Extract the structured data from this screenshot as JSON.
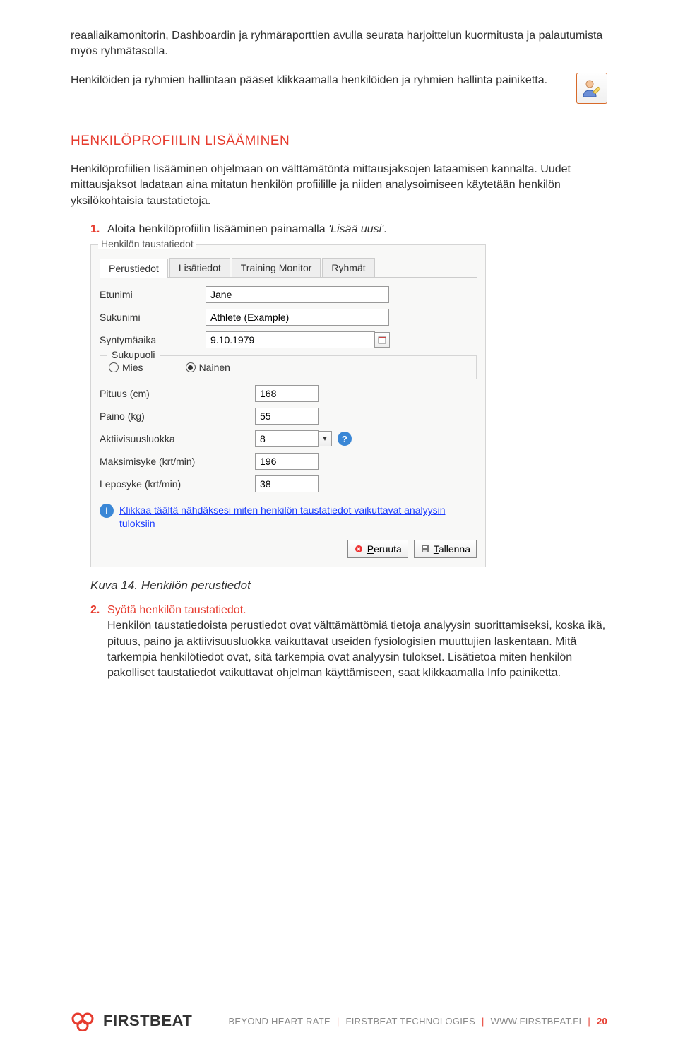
{
  "intro": {
    "p1": "reaaliaikamonitorin, Dashboardin ja ryhmäraporttien avulla seurata harjoittelun kuormitusta ja palautumista myös ryhmätasolla.",
    "p2": "Henkilöiden ja ryhmien hallintaan pääset klikkaamalla henkilöiden ja ryhmien hallinta painiketta."
  },
  "section_heading": "HENKILÖPROFIILIN LISÄÄMINEN",
  "section_p": "Henkilöprofiilien lisääminen ohjelmaan on välttämätöntä mittausjaksojen lataamisen kannalta. Uudet mittausjaksot ladataan aina mitatun henkilön profiilille ja niiden analysoimiseen käytetään henkilön yksilökohtaisia taustatietoja.",
  "steps": {
    "one": {
      "num": "1.",
      "text_a": "Aloita henkilöprofiilin lisääminen painamalla ",
      "text_b": "'Lisää uusi'",
      "text_c": "."
    },
    "two": {
      "num": "2.",
      "bold": "Syötä henkilön taustatiedot.",
      "body": "Henkilön taustatiedoista perustiedot ovat välttämättömiä tietoja analyysin suorittamiseksi, koska ikä, pituus, paino ja aktiivisuusluokka vaikuttavat useiden fysiologisien muuttujien laskentaan. Mitä tarkempia henkilötiedot ovat, sitä tarkempia ovat analyysin tulokset. Lisätietoa miten henkilön pakolliset taustatiedot vaikuttavat ohjelman käyttämiseen, saat klikkaamalla Info painiketta."
    }
  },
  "caption": "Kuva 14. Henkilön perustiedot",
  "dialog": {
    "group_legend": "Henkilön taustatiedot",
    "tabs": [
      "Perustiedot",
      "Lisätiedot",
      "Training Monitor",
      "Ryhmät"
    ],
    "firstname_lbl": "Etunimi",
    "firstname_val": "Jane",
    "lastname_lbl": "Sukunimi",
    "lastname_val": "Athlete (Example)",
    "dob_lbl": "Syntymäaika",
    "dob_val": "9.10.1979",
    "gender_legend": "Sukupuoli",
    "gender_male": "Mies",
    "gender_female": "Nainen",
    "height_lbl": "Pituus (cm)",
    "height_val": "168",
    "weight_lbl": "Paino (kg)",
    "weight_val": "55",
    "activity_lbl": "Aktiivisuusluokka",
    "activity_val": "8",
    "maxhr_lbl": "Maksimisyke (krt/min)",
    "maxhr_val": "196",
    "resthr_lbl": "Leposyke (krt/min)",
    "resthr_val": "38",
    "info_link": "Klikkaa täältä nähdäksesi miten henkilön taustatiedot vaikuttavat analyysin tuloksiin",
    "cancel_btn": "Peruuta",
    "save_btn": "Tallenna"
  },
  "footer": {
    "brand": "FIRSTBEAT",
    "tagline": "BEYOND HEART RATE",
    "company": "FIRSTBEAT TECHNOLOGIES",
    "url": "WWW.FIRSTBEAT.FI",
    "page": "20"
  }
}
